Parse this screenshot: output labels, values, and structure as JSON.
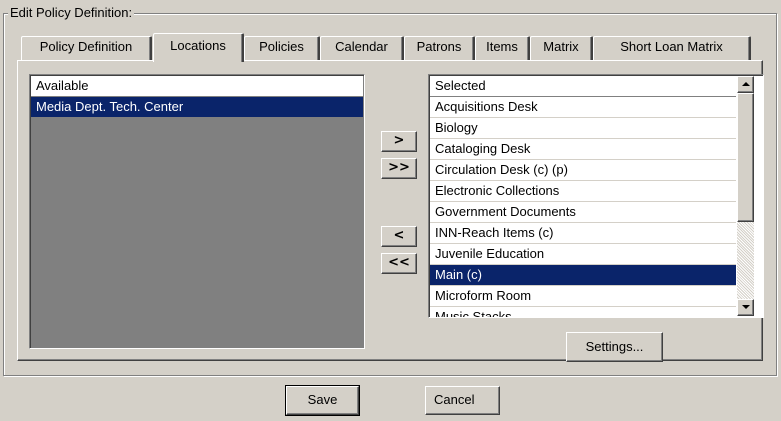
{
  "dialog": {
    "group_label": "Edit  Policy Definition:"
  },
  "tabs": [
    {
      "label": "Policy Definition",
      "active": false
    },
    {
      "label": "Locations",
      "active": true
    },
    {
      "label": "Policies",
      "active": false
    },
    {
      "label": "Calendar",
      "active": false
    },
    {
      "label": "Patrons",
      "active": false
    },
    {
      "label": "Items",
      "active": false
    },
    {
      "label": "Matrix",
      "active": false
    },
    {
      "label": "Short Loan Matrix",
      "active": false
    }
  ],
  "available": {
    "header": "Available",
    "items": [
      "Media Dept. Tech. Center"
    ],
    "selected_item": "Media Dept. Tech. Center"
  },
  "selected": {
    "header": "Selected",
    "items": [
      "Acquisitions Desk",
      "Biology",
      "Cataloging Desk",
      "Circulation Desk (c) (p)",
      "Electronic Collections",
      "Government Documents",
      "INN-Reach Items (c)",
      "Juvenile Education",
      "Main (c)",
      "Microform Room",
      "Music Stacks"
    ],
    "highlighted_item": "Main (c)"
  },
  "transfer_buttons": {
    "add_one": ">",
    "add_all": ">>",
    "remove_one": "<",
    "remove_all": "<<"
  },
  "buttons": {
    "settings": "Settings...",
    "save": "Save",
    "cancel": "Cancel"
  },
  "colors": {
    "window": "#d4d0c8",
    "selection": "#0a246a",
    "list_background": "#ffffff",
    "empty_list_area": "#808080"
  }
}
